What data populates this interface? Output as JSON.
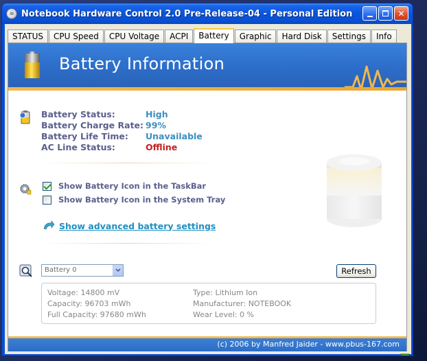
{
  "window": {
    "title": "Notebook Hardware Control 2.0 Pre-Release-04  -  Personal Edition"
  },
  "tabs": [
    {
      "label": "STATUS"
    },
    {
      "label": "CPU Speed"
    },
    {
      "label": "CPU Voltage"
    },
    {
      "label": "ACPI"
    },
    {
      "label": "Battery"
    },
    {
      "label": "Graphic"
    },
    {
      "label": "Hard Disk"
    },
    {
      "label": "Settings"
    },
    {
      "label": "Info"
    }
  ],
  "active_tab": "Battery",
  "header": {
    "title": "Battery Information"
  },
  "status": {
    "battery_status_label": "Battery Status:",
    "battery_status_value": "High",
    "charge_rate_label": "Battery Charge Rate:",
    "charge_rate_value": "99%",
    "life_time_label": "Battery Life Time:",
    "life_time_value": "Unavailable",
    "ac_line_label": "AC Line Status:",
    "ac_line_value": "Offline"
  },
  "options": {
    "taskbar_label": "Show Battery Icon in the TaskBar",
    "taskbar_checked": true,
    "tray_label": "Show Battery Icon in the System Tray",
    "tray_checked": false,
    "advanced_link": "Show advanced battery settings"
  },
  "battery_select": {
    "selected": "Battery 0"
  },
  "refresh_label": "Refresh",
  "details": {
    "voltage": "Voltage:  14800 mV",
    "capacity": "Capacity:  96703 mWh",
    "full_capacity": "Full Capacity:  97680 mWh",
    "type": "Type:  Lithium Ion",
    "manufacturer": "Manufacturer:  NOTEBOOK",
    "wear_level": "Wear Level:  0 %"
  },
  "footer": {
    "text": "(c) 2006 by Manfred Jaider  -  www.pbus-167.com"
  },
  "colors": {
    "title_bar": "#0a55dc",
    "header": "#2d6fcb",
    "accent_orange": "#f2b84c",
    "label": "#5a5f8e",
    "value_blue": "#3b8ec2",
    "value_red": "#c42020",
    "link": "#1e8fc2"
  }
}
